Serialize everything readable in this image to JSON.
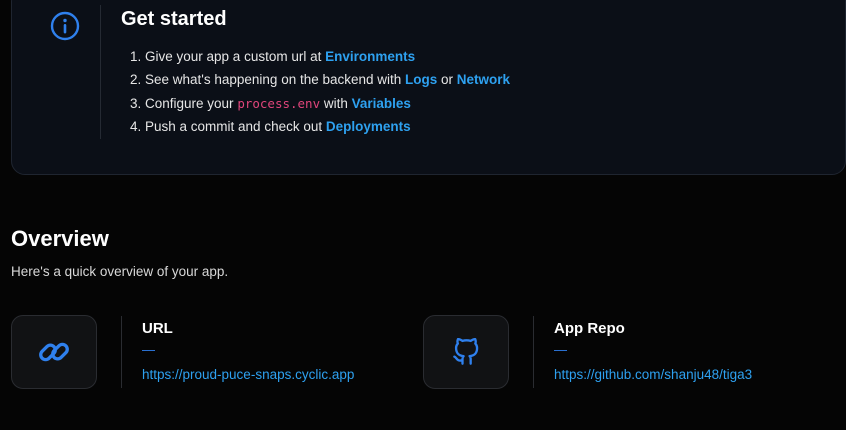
{
  "get_started": {
    "title": "Get started",
    "icon": "info-circle-icon",
    "steps": [
      {
        "prefix": "1. Give your app a custom url at ",
        "link": "Environments"
      },
      {
        "prefix": "2. See what's happening on the backend with ",
        "link": "Logs",
        "middle": " or ",
        "link2": "Network"
      },
      {
        "prefix": "3. Configure your ",
        "code": "process.env",
        "middle": " with ",
        "link": "Variables"
      },
      {
        "prefix": "4. Push a commit and check out ",
        "link": "Deployments"
      }
    ]
  },
  "overview": {
    "title": "Overview",
    "subtitle": "Here's a quick overview of your app.",
    "items": [
      {
        "icon": "link-icon",
        "title": "URL",
        "dash": "—",
        "value": "https://proud-puce-snaps.cyclic.app"
      },
      {
        "icon": "github-icon",
        "title": "App Repo",
        "dash": "—",
        "value": "https://github.com/shanju48/tiga3"
      }
    ]
  },
  "colors": {
    "background": "#050505",
    "card": "#0b0f17",
    "accent": "#2ea1f0",
    "code": "#e0457b",
    "icon": "#2f80ed"
  }
}
